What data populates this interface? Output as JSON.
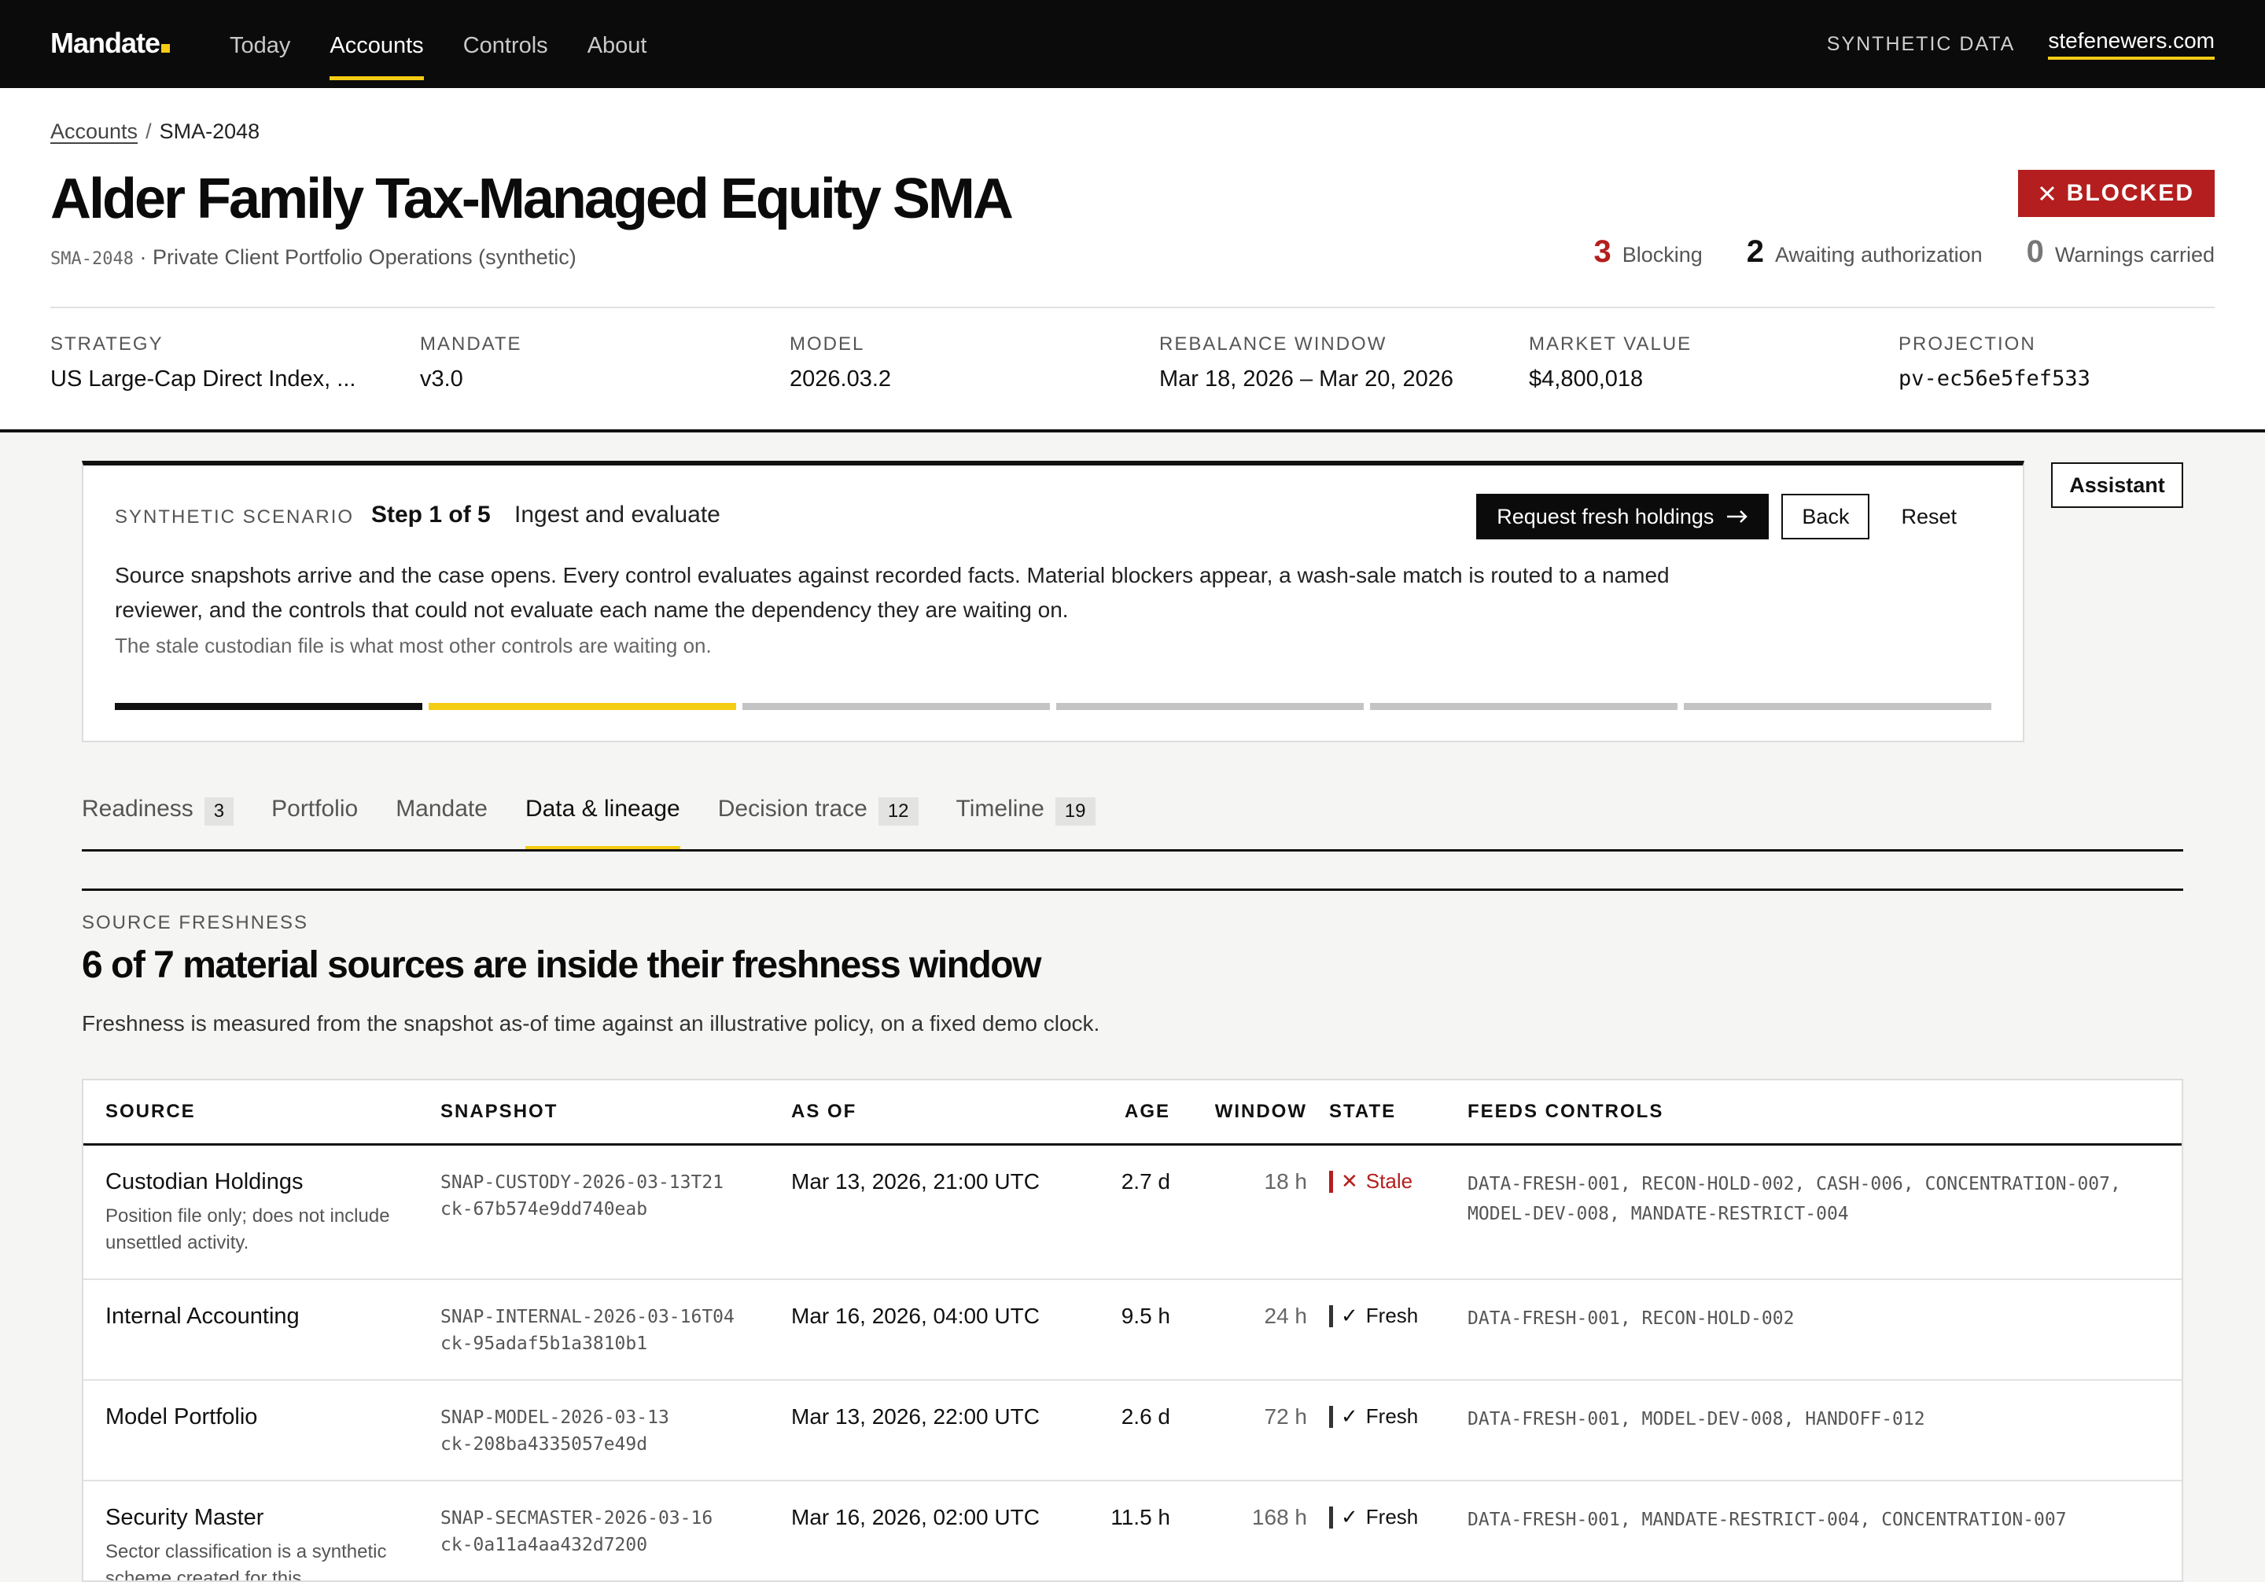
{
  "nav": {
    "brand": "Mandate",
    "links": [
      "Today",
      "Accounts",
      "Controls",
      "About"
    ],
    "synthetic_label": "SYNTHETIC DATA",
    "site_link": "stefenewers.com"
  },
  "breadcrumb": {
    "parent": "Accounts",
    "separator": "/",
    "current": "SMA-2048"
  },
  "account": {
    "title": "Alder Family Tax-Managed Equity SMA",
    "code": "SMA-2048",
    "subtitle_rest": " · Private Client Portfolio Operations (synthetic)",
    "status": "BLOCKED",
    "counts": [
      {
        "value": "3",
        "label": "Blocking"
      },
      {
        "value": "2",
        "label": "Awaiting authorization"
      },
      {
        "value": "0",
        "label": "Warnings carried"
      }
    ],
    "facts": [
      {
        "label": "Strategy",
        "value": "US Large-Cap Direct Index, ..."
      },
      {
        "label": "Mandate",
        "value": "v3.0"
      },
      {
        "label": "Model",
        "value": "2026.03.2"
      },
      {
        "label": "Rebalance window",
        "value": "Mar 18, 2026 – Mar 20, 2026"
      },
      {
        "label": "Market value",
        "value": "$4,800,018"
      },
      {
        "label": "Projection",
        "value": "pv-ec56e5fef533"
      }
    ]
  },
  "scenario": {
    "kicker": "SYNTHETIC SCENARIO",
    "step": "Step 1 of 5",
    "stage": "Ingest and evaluate",
    "primary_action": "Request fresh holdings",
    "back_label": "Back",
    "reset_label": "Reset",
    "description": "Source snapshots arrive and the case opens. Every control evaluates against recorded facts. Material blockers appear, a wash-sale match is routed to a named reviewer, and the controls that could not evaluate each name the dependency they are waiting on.",
    "note": "The stale custodian file is what most other controls are waiting on.",
    "progress_segments": 6,
    "progress_done": 1,
    "progress_current": 2
  },
  "assistant_label": "Assistant",
  "tabs": [
    {
      "label": "Readiness",
      "count": "3"
    },
    {
      "label": "Portfolio",
      "count": ""
    },
    {
      "label": "Mandate",
      "count": ""
    },
    {
      "label": "Data & lineage",
      "count": "",
      "active": true
    },
    {
      "label": "Decision trace",
      "count": "12"
    },
    {
      "label": "Timeline",
      "count": "19"
    }
  ],
  "freshness": {
    "kicker": "SOURCE FRESHNESS",
    "title": "6 of 7 material sources are inside their freshness window",
    "description": "Freshness is measured from the snapshot as-of time against an illustrative policy, on a fixed demo clock.",
    "columns": [
      "SOURCE",
      "SNAPSHOT",
      "AS OF",
      "AGE",
      "WINDOW",
      "STATE",
      "FEEDS CONTROLS"
    ],
    "rows": [
      {
        "source": "Custodian Holdings",
        "note": "Position file only; does not include unsettled activity.",
        "snapshot": "SNAP-CUSTODY-2026-03-13T21",
        "checksum": "ck-67b574e9dd740eab",
        "as_of": "Mar 13, 2026, 21:00 UTC",
        "age": "2.7 d",
        "window": "18 h",
        "state": "Stale",
        "state_icon": "✕",
        "stale": true,
        "feeds": "DATA-FRESH-001, RECON-HOLD-002, CASH-006, CONCENTRATION-007, MODEL-DEV-008, MANDATE-RESTRICT-004"
      },
      {
        "source": "Internal Accounting",
        "note": "",
        "snapshot": "SNAP-INTERNAL-2026-03-16T04",
        "checksum": "ck-95adaf5b1a3810b1",
        "as_of": "Mar 16, 2026, 04:00 UTC",
        "age": "9.5 h",
        "window": "24 h",
        "state": "Fresh",
        "state_icon": "✓",
        "stale": false,
        "feeds": "DATA-FRESH-001, RECON-HOLD-002"
      },
      {
        "source": "Model Portfolio",
        "note": "",
        "snapshot": "SNAP-MODEL-2026-03-13",
        "checksum": "ck-208ba4335057e49d",
        "as_of": "Mar 13, 2026, 22:00 UTC",
        "age": "2.6 d",
        "window": "72 h",
        "state": "Fresh",
        "state_icon": "✓",
        "stale": false,
        "feeds": "DATA-FRESH-001, MODEL-DEV-008, HANDOFF-012"
      },
      {
        "source": "Security Master",
        "note": "Sector classification is a synthetic scheme created for this",
        "snapshot": "SNAP-SECMASTER-2026-03-16",
        "checksum": "ck-0a11a4aa432d7200",
        "as_of": "Mar 16, 2026, 02:00 UTC",
        "age": "11.5 h",
        "window": "168 h",
        "state": "Fresh",
        "state_icon": "✓",
        "stale": false,
        "feeds": "DATA-FRESH-001, MANDATE-RESTRICT-004, CONCENTRATION-007"
      }
    ]
  }
}
